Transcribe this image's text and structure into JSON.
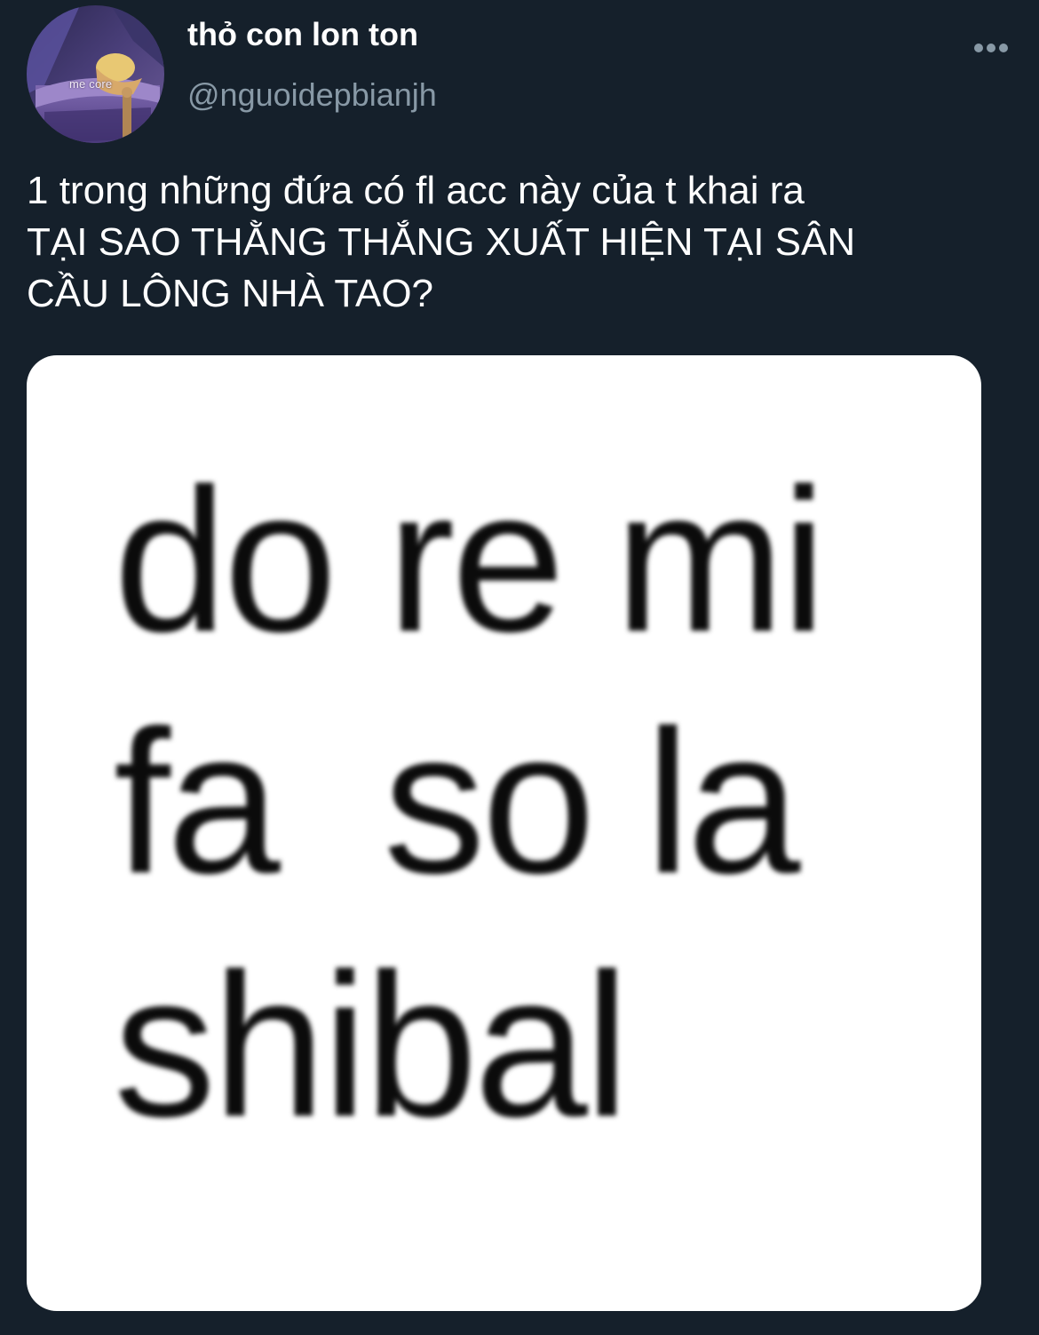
{
  "author": {
    "display_name": "thỏ con lon ton",
    "username": "@nguoidepbianjh",
    "avatar_caption": "me core"
  },
  "tweet": {
    "text": "1 trong những đứa có fl acc này của t khai ra\nTẠI SAO THẰNG THẮNG XUẤT HIỆN TẠI SÂN\nCẦU LÔNG NHÀ TAO?"
  },
  "media": {
    "lines": [
      "do re mi",
      "fa  so la",
      "shibal"
    ]
  },
  "icons": {
    "more": "more-horizontal-icon"
  },
  "colors": {
    "background": "#15202b",
    "text_primary": "#ffffff",
    "text_secondary": "#8899a6",
    "media_background": "#ffffff"
  }
}
